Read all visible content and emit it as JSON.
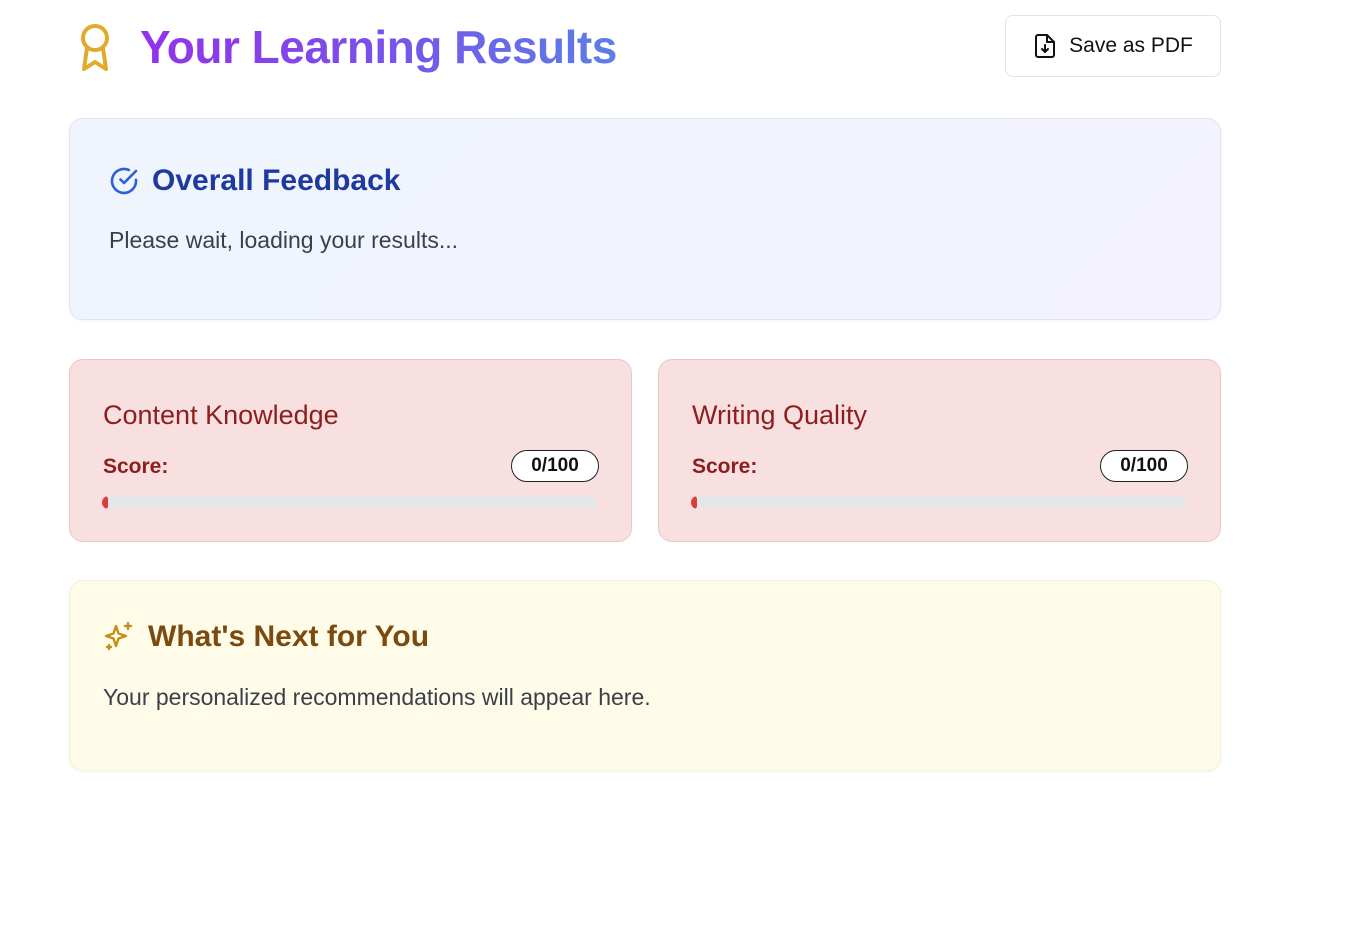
{
  "header": {
    "title": "Your Learning Results",
    "title_icon": "award-icon",
    "save_pdf_label": "Save as PDF",
    "save_pdf_icon": "file-download-icon"
  },
  "feedback": {
    "title": "Overall Feedback",
    "icon": "circle-check-icon",
    "text": "Please wait, loading your results..."
  },
  "scores": [
    {
      "title": "Content Knowledge",
      "score_label": "Score:",
      "score_text": "0/100",
      "score_value": 0,
      "score_max": 100
    },
    {
      "title": "Writing Quality",
      "score_label": "Score:",
      "score_text": "0/100",
      "score_value": 0,
      "score_max": 100
    }
  ],
  "next": {
    "title": "What's Next for You",
    "icon": "sparkles-icon",
    "text": "Your personalized recommendations will appear here."
  },
  "colors": {
    "title_gradient_start": "#9333ea",
    "title_gradient_end": "#5b7fe6",
    "feedback_title": "#1e3a9e",
    "score_text": "#8f1d1d",
    "score_card_bg": "#f8e0e0",
    "progress_fill": "#dc3b3b",
    "next_title": "#7a4a10",
    "next_card_bg": "#fefce8",
    "award_icon": "#e0ab2c"
  }
}
